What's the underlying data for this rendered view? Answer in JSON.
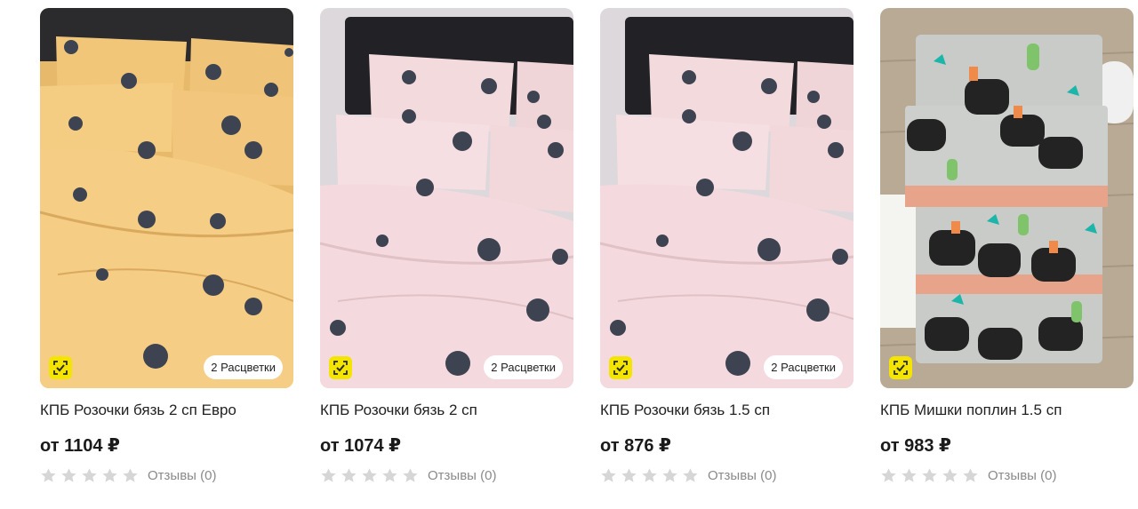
{
  "products": [
    {
      "title": "КПБ Розочки бязь 2 сп Евро",
      "price": "от 1104 ₽",
      "colors_badge": "2 Расцветки",
      "reviews": "Отзывы (0)",
      "rating": 0,
      "fabric_color": "#f2c67a",
      "icon": "verified-check-icon"
    },
    {
      "title": "КПБ Розочки бязь 2 сп",
      "price": "от 1074 ₽",
      "colors_badge": "2 Расцветки",
      "reviews": "Отзывы (0)",
      "rating": 0,
      "fabric_color": "#f1d6d9",
      "icon": "verified-check-icon"
    },
    {
      "title": "КПБ Розочки бязь 1.5 сп",
      "price": "от 876 ₽",
      "colors_badge": "2 Расцветки",
      "reviews": "Отзывы (0)",
      "rating": 0,
      "fabric_color": "#f1d6d9",
      "icon": "verified-check-icon"
    },
    {
      "title": "КПБ Мишки поплин 1.5 сп",
      "price": "от 983 ₽",
      "reviews": "Отзывы (0)",
      "rating": 0,
      "fabric_color": "#c9cbc8",
      "icon": "verified-check-icon"
    }
  ],
  "colors": {
    "check_badge": "#f3e500",
    "star_empty": "#d6d6d6",
    "reviews_text": "#8a8a8a"
  }
}
